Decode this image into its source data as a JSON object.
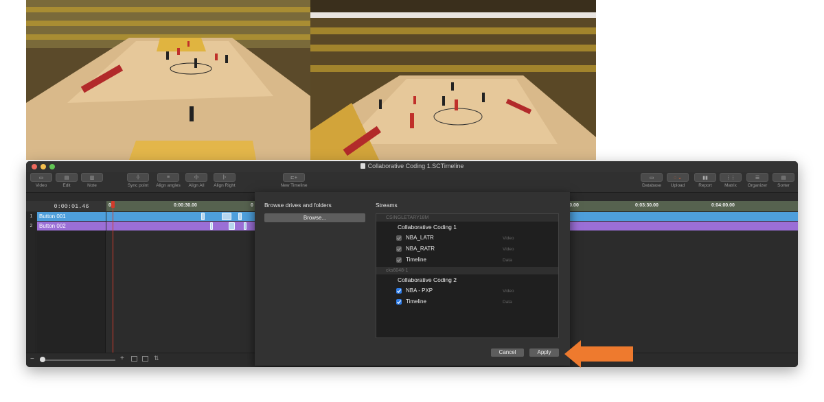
{
  "window": {
    "title": "Collaborative Coding 1.SCTimeline"
  },
  "toolbar": {
    "left": [
      {
        "label": "Video",
        "icon": "video-icon"
      },
      {
        "label": "Edit",
        "icon": "edit-icon"
      },
      {
        "label": "Note",
        "icon": "note-icon"
      },
      {
        "label": "Sync point",
        "icon": "sync-point-icon"
      },
      {
        "label": "Align angles",
        "icon": "align-angles-icon"
      },
      {
        "label": "Align All",
        "icon": "align-all-icon"
      },
      {
        "label": "Align Right",
        "icon": "align-right-icon"
      },
      {
        "label": "New Timeline",
        "icon": "new-timeline-icon"
      }
    ],
    "right": [
      {
        "label": "Database",
        "icon": "database-icon"
      },
      {
        "label": "Upload",
        "icon": "upload-icon"
      },
      {
        "label": "Report",
        "icon": "report-icon"
      },
      {
        "label": "Matrix",
        "icon": "matrix-icon"
      },
      {
        "label": "Organizer",
        "icon": "organizer-icon"
      },
      {
        "label": "Sorter",
        "icon": "sorter-icon"
      }
    ]
  },
  "timeline": {
    "timecode": "0:00:01.46",
    "ruler_labels": [
      "0",
      "0:00:30.00",
      "0",
      ":00.00",
      "0:03:30.00",
      "0:04:00.00"
    ],
    "rows": [
      {
        "num": "1",
        "label": "Button 001",
        "color": "#4e9fdc"
      },
      {
        "num": "2",
        "label": "Button 002",
        "color": "#9b6fd6"
      }
    ]
  },
  "dialog": {
    "browse_heading": "Browse drives and folders",
    "browse_button": "Browse...",
    "streams_heading": "Streams",
    "groups": [
      {
        "header": "CSINGLETARY18M",
        "collection": "Collaborative Coding 1",
        "streams": [
          {
            "name": "NBA_LATR",
            "type": "Video",
            "checked": true,
            "enabled": false
          },
          {
            "name": "NBA_RATR",
            "type": "Video",
            "checked": true,
            "enabled": false
          },
          {
            "name": "Timeline",
            "type": "Data",
            "checked": true,
            "enabled": false
          }
        ]
      },
      {
        "header": "cks6048-1",
        "collection": "Collaborative Coding 2",
        "streams": [
          {
            "name": "NBA - PXP",
            "type": "Video",
            "checked": true,
            "enabled": true
          },
          {
            "name": "Timeline",
            "type": "Data",
            "checked": true,
            "enabled": true
          }
        ]
      }
    ],
    "cancel": "Cancel",
    "apply": "Apply"
  },
  "colors": {
    "accent_arrow": "#ee7a2e",
    "checkbox_blue": "#2f7de8",
    "playhead": "#d23b2b",
    "ruler": "#56624f"
  }
}
